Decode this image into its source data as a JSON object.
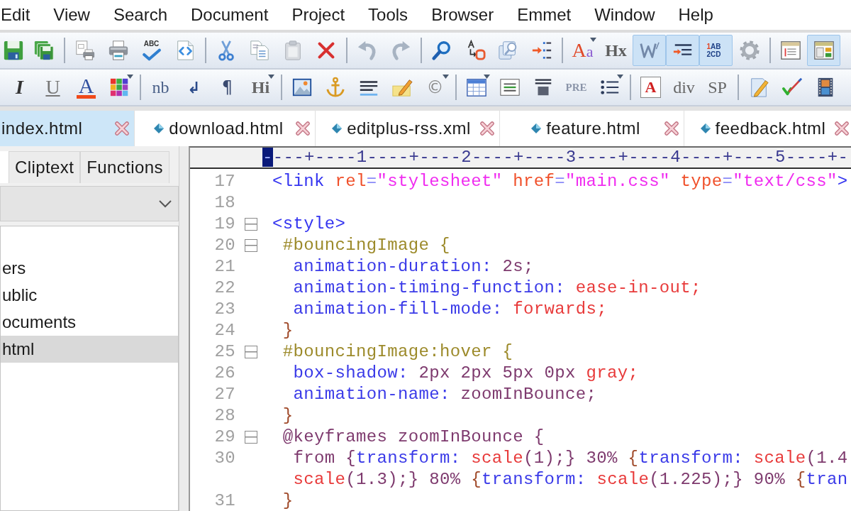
{
  "menu_bar": [
    "Edit",
    "View",
    "Search",
    "Document",
    "Project",
    "Tools",
    "Browser",
    "Emmet",
    "Window",
    "Help"
  ],
  "toolbars": [
    {
      "items": [
        {
          "kind": "icon",
          "pressed": false
        },
        {
          "kind": "icon",
          "pressed": false
        },
        {
          "kind": "separator"
        },
        {
          "kind": "icon",
          "pressed": false
        },
        {
          "kind": "icon",
          "pressed": false
        },
        {
          "kind": "icon-text",
          "label": "ABC",
          "pressed": false
        },
        {
          "kind": "icon",
          "pressed": false
        },
        {
          "kind": "separator"
        },
        {
          "kind": "icon",
          "pressed": false
        },
        {
          "kind": "icon",
          "pressed": false
        },
        {
          "kind": "icon",
          "pressed": false
        },
        {
          "kind": "icon",
          "pressed": false
        },
        {
          "kind": "separator"
        },
        {
          "kind": "icon",
          "pressed": false
        },
        {
          "kind": "icon",
          "pressed": false
        },
        {
          "kind": "separator"
        },
        {
          "kind": "icon",
          "pressed": false
        },
        {
          "kind": "icon",
          "pressed": false
        },
        {
          "kind": "icon",
          "pressed": false
        },
        {
          "kind": "icon",
          "pressed": false
        },
        {
          "kind": "separator"
        },
        {
          "kind": "text",
          "label": "Aa",
          "pressed": false
        },
        {
          "kind": "text",
          "label": "Hx",
          "pressed": false
        },
        {
          "kind": "icon",
          "pressed": true
        },
        {
          "kind": "icon",
          "pressed": true
        },
        {
          "kind": "text",
          "label": "1AB 2CD",
          "pressed": true
        },
        {
          "kind": "icon",
          "pressed": false
        },
        {
          "kind": "separator"
        },
        {
          "kind": "icon",
          "pressed": false
        },
        {
          "kind": "icon",
          "pressed": true
        }
      ]
    },
    {
      "items": [
        {
          "kind": "text",
          "label": "I",
          "pressed": false
        },
        {
          "kind": "text",
          "label": "U",
          "pressed": false
        },
        {
          "kind": "text",
          "label": "A",
          "pressed": false
        },
        {
          "kind": "icon",
          "pressed": false
        },
        {
          "kind": "separator"
        },
        {
          "kind": "text",
          "label": "nb",
          "pressed": false
        },
        {
          "kind": "text",
          "label": "↲",
          "pressed": false
        },
        {
          "kind": "text",
          "label": "¶",
          "pressed": false
        },
        {
          "kind": "text",
          "label": "Hi",
          "pressed": false
        },
        {
          "kind": "separator"
        },
        {
          "kind": "icon",
          "pressed": false
        },
        {
          "kind": "icon",
          "pressed": false
        },
        {
          "kind": "icon",
          "pressed": false
        },
        {
          "kind": "icon",
          "pressed": false
        },
        {
          "kind": "text",
          "label": "©",
          "pressed": false
        },
        {
          "kind": "separator"
        },
        {
          "kind": "icon",
          "pressed": false
        },
        {
          "kind": "icon",
          "pressed": false
        },
        {
          "kind": "icon",
          "pressed": false
        },
        {
          "kind": "text",
          "label": "PRE",
          "pressed": false
        },
        {
          "kind": "icon",
          "pressed": false
        },
        {
          "kind": "separator"
        },
        {
          "kind": "text",
          "label": "A",
          "pressed": false
        },
        {
          "kind": "text",
          "label": "div",
          "pressed": false
        },
        {
          "kind": "text",
          "label": "SP",
          "pressed": false
        },
        {
          "kind": "separator"
        },
        {
          "kind": "icon",
          "pressed": false
        },
        {
          "kind": "icon",
          "pressed": false
        },
        {
          "kind": "icon",
          "pressed": false
        }
      ]
    }
  ],
  "file_tabs": [
    {
      "label": "index.html",
      "selected": true,
      "file_icon": false
    },
    {
      "label": "download.html",
      "selected": false,
      "file_icon": true
    },
    {
      "label": "editplus-rss.xml",
      "selected": false,
      "file_icon": true
    },
    {
      "label": "feature.html",
      "selected": false,
      "file_icon": true
    },
    {
      "label": "feedback.html",
      "selected": false,
      "file_icon": true
    }
  ],
  "side_panel": {
    "tabs": [
      {
        "selected": true
      },
      {
        "label": "Cliptext",
        "selected": false
      },
      {
        "label": "Functions",
        "selected": false
      }
    ],
    "items": [
      {
        "label": "ers",
        "selected": false
      },
      {
        "label": "ublic",
        "selected": false
      },
      {
        "label": "ocuments",
        "selected": false
      },
      {
        "label": "html",
        "selected": true
      }
    ]
  },
  "editor": {
    "ruler": {
      "marker": "-",
      "text": "---+----1----+----2----+----3----+----4----+----5----+-"
    },
    "lines": [
      {
        "number": "17",
        "fold": false,
        "tokens": [
          {
            "kind": "tag",
            "text": "<link"
          },
          {
            "kind": "attr",
            "text": " rel"
          },
          {
            "kind": "op",
            "text": "="
          },
          {
            "kind": "string",
            "text": "\"stylesheet\""
          },
          {
            "kind": "attr",
            "text": " href"
          },
          {
            "kind": "op",
            "text": "="
          },
          {
            "kind": "string",
            "text": "\"main.css\""
          },
          {
            "kind": "attr",
            "text": " type"
          },
          {
            "kind": "op",
            "text": "="
          },
          {
            "kind": "string",
            "text": "\"text/css\""
          },
          {
            "kind": "tag",
            "text": ">"
          }
        ]
      },
      {
        "number": "18",
        "fold": false
      },
      {
        "number": "19",
        "fold": true,
        "tokens": [
          {
            "kind": "tag",
            "text": "<style>"
          }
        ]
      },
      {
        "number": "20",
        "fold": true,
        "tokens": [
          {
            "kind": "selector",
            "text": " #bouncingImage {"
          }
        ]
      },
      {
        "number": "21",
        "fold": false,
        "tokens": [
          {
            "kind": "property",
            "text": "  animation-duration:"
          },
          {
            "kind": "text",
            "text": " 2s;"
          }
        ]
      },
      {
        "number": "22",
        "fold": false,
        "tokens": [
          {
            "kind": "property",
            "text": "  animation-timing-function:"
          },
          {
            "kind": "value",
            "text": " ease-in-out;"
          }
        ]
      },
      {
        "number": "23",
        "fold": false,
        "tokens": [
          {
            "kind": "property",
            "text": "  animation-fill-mode:"
          },
          {
            "kind": "value",
            "text": " forwards;"
          }
        ]
      },
      {
        "number": "24",
        "fold": false,
        "tokens": [
          {
            "kind": "brace",
            "text": " }"
          }
        ]
      },
      {
        "number": "25",
        "fold": true,
        "tokens": [
          {
            "kind": "selector",
            "text": " #bouncingImage:hover {"
          }
        ]
      },
      {
        "number": "26",
        "fold": false,
        "tokens": [
          {
            "kind": "property",
            "text": "  box-shadow:"
          },
          {
            "kind": "text",
            "text": " 2px 2px 5px 0px"
          },
          {
            "kind": "value",
            "text": " gray;"
          }
        ]
      },
      {
        "number": "27",
        "fold": false,
        "tokens": [
          {
            "kind": "property",
            "text": "  animation-name:"
          },
          {
            "kind": "text",
            "text": " zoomInBounce;"
          }
        ]
      },
      {
        "number": "28",
        "fold": false,
        "tokens": [
          {
            "kind": "brace",
            "text": " }"
          }
        ]
      },
      {
        "number": "29",
        "fold": true,
        "tokens": [
          {
            "kind": "text",
            "text": " @keyframes zoomInBounce {"
          }
        ]
      },
      {
        "number": "30",
        "fold": false,
        "tokens": [
          {
            "kind": "text",
            "text": "  from {"
          },
          {
            "kind": "property",
            "text": "transform:"
          },
          {
            "kind": "value",
            "text": " scale"
          },
          {
            "kind": "text",
            "text": "(1);}"
          },
          {
            "kind": "text",
            "text": " 30%"
          },
          {
            "kind": "brace",
            "text": " {"
          },
          {
            "kind": "property",
            "text": "transform:"
          },
          {
            "kind": "value",
            "text": " scale"
          },
          {
            "kind": "text",
            "text": "(1.4"
          }
        ],
        "wrap": [
          {
            "kind": "value",
            "text": "  scale"
          },
          {
            "kind": "text",
            "text": "(1.3);}"
          },
          {
            "kind": "text",
            "text": " 80%"
          },
          {
            "kind": "brace",
            "text": " {"
          },
          {
            "kind": "property",
            "text": "transform:"
          },
          {
            "kind": "value",
            "text": " scale"
          },
          {
            "kind": "text",
            "text": "(1.225);}"
          },
          {
            "kind": "text",
            "text": " 90%"
          },
          {
            "kind": "brace",
            "text": " {"
          },
          {
            "kind": "property",
            "text": "tran"
          }
        ]
      },
      {
        "number": "31",
        "fold": false,
        "tokens": [
          {
            "kind": "brace",
            "text": " }"
          }
        ]
      }
    ]
  }
}
